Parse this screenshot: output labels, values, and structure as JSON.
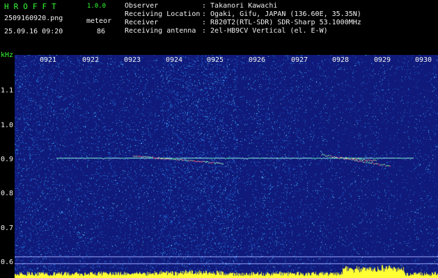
{
  "header": {
    "title": "HROFFT",
    "version": "1.0.0",
    "filename": "2509160920.png",
    "mode": "meteor",
    "datetime": "25.09.16 09:20",
    "count": "86"
  },
  "meta": [
    {
      "label": "Observer",
      "value": ": Takanori Kawachi"
    },
    {
      "label": "Receiving Location",
      "value": ": Ogaki, Gifu, JAPAN (136.60E, 35.35N)"
    },
    {
      "label": "Receiver",
      "value": ": R820T2(RTL-SDR) SDR-Sharp 53.1000MHz"
    },
    {
      "label": "Receiving antenna",
      "value": ": 2el-HB9CV Vertical (el. E-W)"
    }
  ],
  "axis": {
    "unit": "kHz",
    "y_ticks": [
      "1.1",
      "1.0",
      "0.9",
      "0.8",
      "0.7",
      "0.6"
    ],
    "x_ticks": [
      "0921",
      "0922",
      "0923",
      "0924",
      "0925",
      "0926",
      "0927",
      "0928",
      "0929",
      "0930"
    ]
  },
  "colors": {
    "background": "#101a7a",
    "noise": "#2aa0ff",
    "carrier": "#9ff8ff",
    "label_green": "#33ff33",
    "label_white": "#f2f2f2",
    "level_bars": "#ffff33"
  }
}
